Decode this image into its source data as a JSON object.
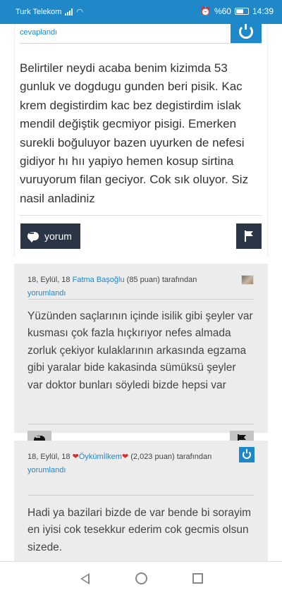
{
  "status_bar": {
    "carrier": "Turk Telekom",
    "battery": "%60",
    "time": "14:39"
  },
  "question": {
    "meta_text": "cevaplandı",
    "body": "Belirtiler neydi acaba benim kizimda 53 gunluk ve dogdugu gunden beri pisik. Kac krem degistirdim kac bez degistirdim islak mendil değiştik gecmiyor pisigi. Emerken surekli boğuluyor bazen uyurken de nefesi gidiyor hı hıı yapiyo hemen kosup sirtina vuruyorum filan geciyor. Cok sık oluyor. Siz nasil anladiniz",
    "comment_label": "yorum"
  },
  "answers": [
    {
      "date": "18, Eylül, 18",
      "user": "Fatma Başoğlu",
      "points": "(85 puan)",
      "suffix": "tarafından",
      "action": "yorumlandı",
      "body": "Yüzünden saçlarının içinde isilik gibi şeyler var kusması çok fazla hıçkırıyor nefes almada zorluk çekiyor kulaklarının arkasında egzama gibi yaralar bide kakasinda sümüksü şeyler var doktor bunları söyledi bizde hepsi var"
    },
    {
      "date": "18, Eylül, 18",
      "heart": "❤",
      "user": "Öykümİlkem",
      "points": "(2,023 puan)",
      "suffix": "tarafından",
      "action": "yorumlandı",
      "body": "Hadi ya bazilari bizde de var bende bi sorayim en iyisi cok tesekkur ederim cok gecmis olsun sizede."
    }
  ],
  "colors": {
    "accent": "#1e88c9",
    "dark_button": "#2a3645",
    "answer_bg": "#ececec",
    "heart": "#d32f2f"
  }
}
